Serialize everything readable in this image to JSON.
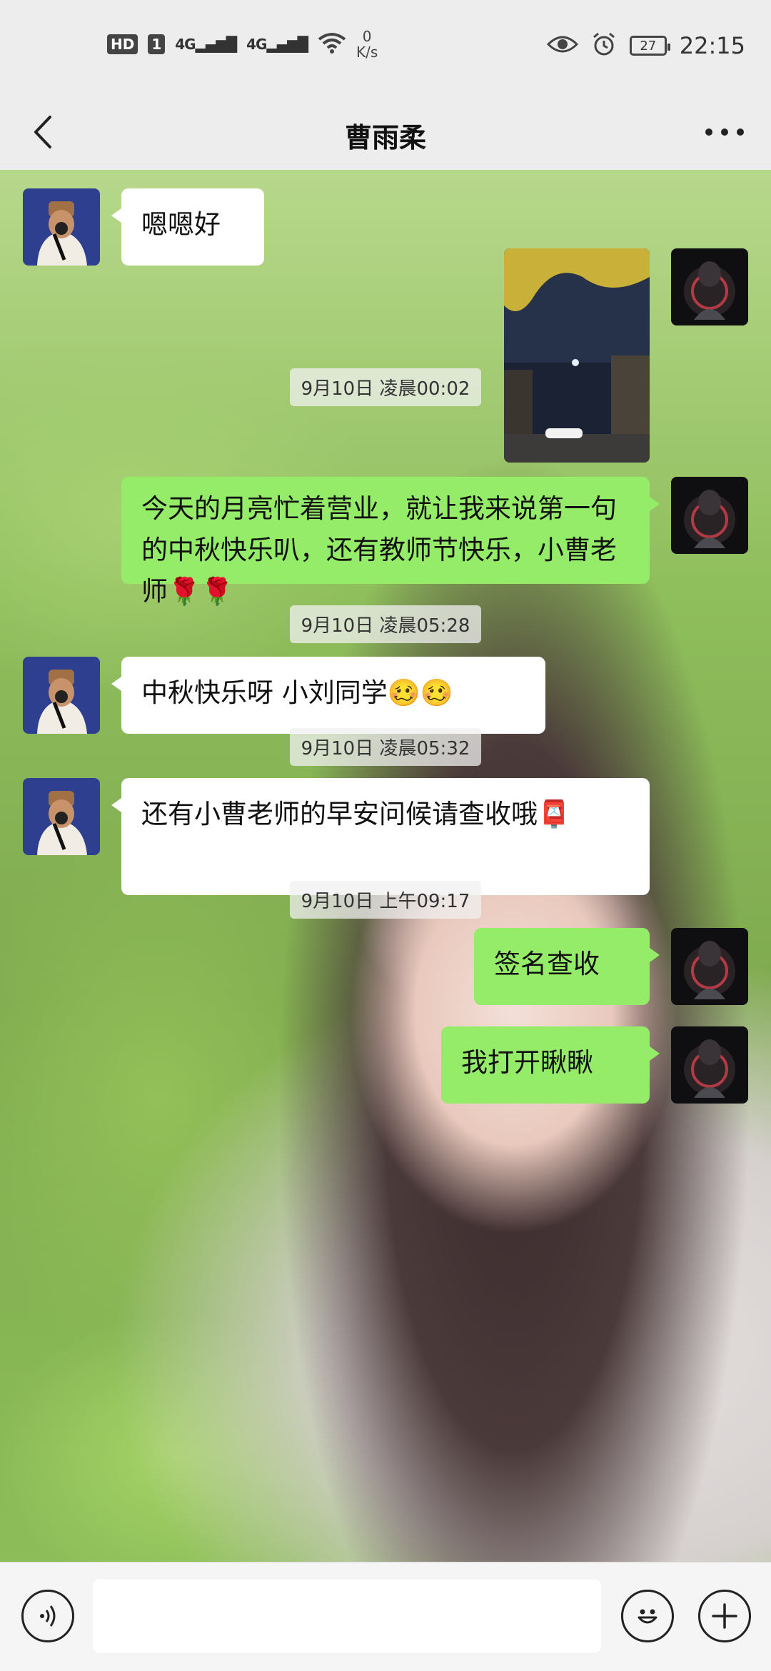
{
  "status_bar": {
    "hd_badge": "HD",
    "sim_badge": "1",
    "signal1": "4G",
    "signal2": "4G",
    "speed_value": "0",
    "speed_unit": "K/s",
    "battery": "27",
    "time": "22:15"
  },
  "header": {
    "title": "曹雨柔",
    "back_icon": "chevron-left-icon",
    "more_icon": "more-dots-icon"
  },
  "messages": [
    {
      "type": "text",
      "side": "left",
      "text": "嗯嗯好"
    },
    {
      "type": "timestamp",
      "text": "9月10日 凌晨00:02"
    },
    {
      "type": "image",
      "side": "right",
      "description_icon": "night-moon-photo"
    },
    {
      "type": "text",
      "side": "right",
      "text": "今天的月亮忙着营业，就让我来说第一句的中秋快乐叭，还有教师节快乐，小曹老师🌹🌹"
    },
    {
      "type": "timestamp",
      "text": "9月10日 凌晨05:28"
    },
    {
      "type": "text",
      "side": "left",
      "text": "中秋快乐呀 小刘同学🥴🥴"
    },
    {
      "type": "timestamp",
      "text": "9月10日 凌晨05:32"
    },
    {
      "type": "text",
      "side": "left",
      "text": "还有小曹老师的早安问候请查收哦📮"
    },
    {
      "type": "timestamp",
      "text": "9月10日 上午09:17"
    },
    {
      "type": "text",
      "side": "right",
      "text": "签名查收"
    },
    {
      "type": "text",
      "side": "right",
      "text": "我打开瞅瞅"
    }
  ],
  "input_bar": {
    "voice_icon": "voice-icon",
    "emoji_icon": "emoji-icon",
    "plus_icon": "plus-icon"
  },
  "colors": {
    "self_bubble": "#95ec69",
    "other_bubble": "#ffffff",
    "bar_background": "#ededed"
  }
}
